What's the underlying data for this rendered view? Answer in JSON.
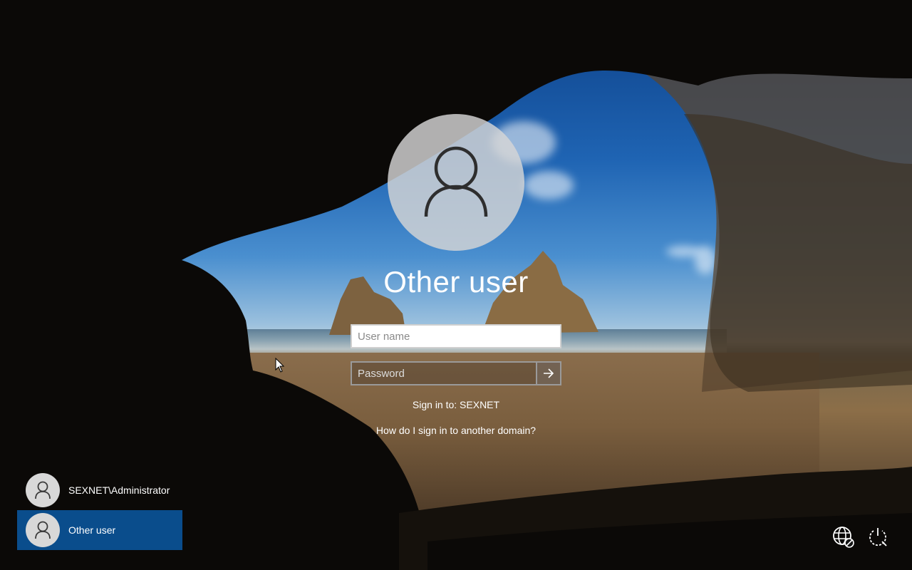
{
  "login": {
    "title": "Other user",
    "username_placeholder": "User name",
    "username_value": "",
    "password_placeholder": "Password",
    "signin_to": "Sign in to: SEXNET",
    "help_link": "How do I sign in to another domain?"
  },
  "users": [
    {
      "label": "SEXNET\\Administrator",
      "selected": false
    },
    {
      "label": "Other user",
      "selected": true
    }
  ],
  "icons": {
    "avatar": "user-icon",
    "submit": "arrow-right-icon",
    "network": "network-globe-icon",
    "power": "power-icon"
  },
  "colors": {
    "selected_user_bg": "#0a4d8c",
    "avatar_bg": "#d6d6d6"
  }
}
